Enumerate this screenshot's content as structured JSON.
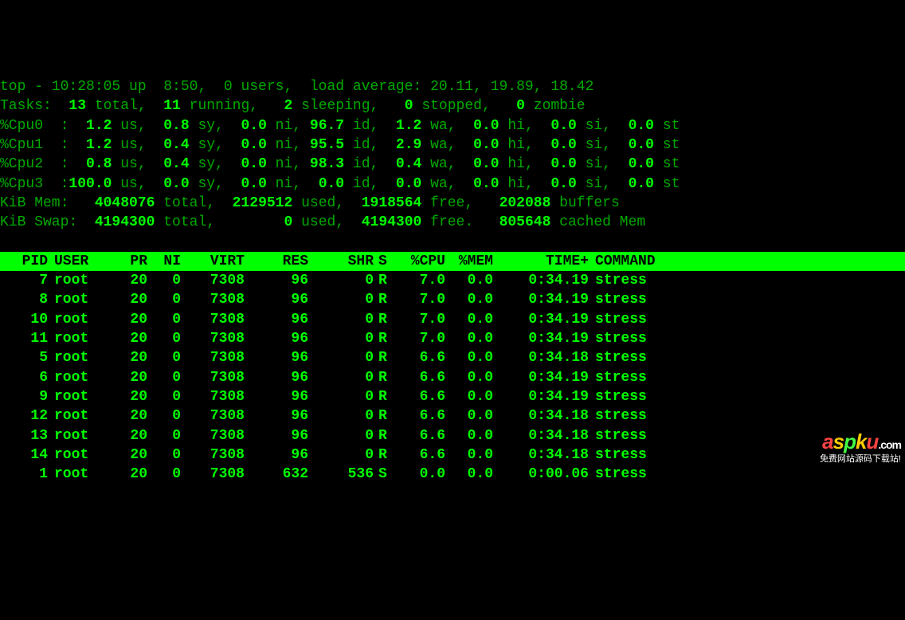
{
  "summary": {
    "top_line_prefix": "top - ",
    "time": "10:28:05",
    "up_label": " up  ",
    "uptime": "8:50",
    "users_sep": ",  ",
    "users_count": "0",
    "users_label": " users,  load average: ",
    "load_avg": "20.11, 19.89, 18.42",
    "tasks_label": "Tasks:  ",
    "tasks_total": "13",
    "tasks_total_lbl": " total,  ",
    "tasks_running": "11",
    "tasks_running_lbl": " running,  ",
    "tasks_sleeping": " 2",
    "tasks_sleeping_lbl": " sleeping,  ",
    "tasks_stopped": " 0",
    "tasks_stopped_lbl": " stopped,  ",
    "tasks_zombie": " 0",
    "tasks_zombie_lbl": " zombie",
    "cpus": [
      {
        "label": "%Cpu0  :  ",
        "us": "1.2",
        "sy": "0.8",
        "ni": "0.0",
        "id": "96.7",
        "wa": "1.2",
        "hi": "0.0",
        "si": "0.0",
        "st": "0.0"
      },
      {
        "label": "%Cpu1  :  ",
        "us": "1.2",
        "sy": "0.4",
        "ni": "0.0",
        "id": "95.5",
        "wa": "2.9",
        "hi": "0.0",
        "si": "0.0",
        "st": "0.0"
      },
      {
        "label": "%Cpu2  :  ",
        "us": "0.8",
        "sy": "0.4",
        "ni": "0.0",
        "id": "98.3",
        "wa": "0.4",
        "hi": "0.0",
        "si": "0.0",
        "st": "0.0"
      },
      {
        "label": "%Cpu3  :",
        "us": "100.0",
        "sy": "0.0",
        "ni": "0.0",
        "id": " 0.0",
        "wa": "0.0",
        "hi": "0.0",
        "si": "0.0",
        "st": "0.0"
      }
    ],
    "mem_label": "KiB Mem:   ",
    "mem_total": "4048076",
    "mem_total_lbl": " total,  ",
    "mem_used": "2129512",
    "mem_used_lbl": " used,  ",
    "mem_free": "1918564",
    "mem_free_lbl": " free,   ",
    "mem_buffers": "202088",
    "mem_buffers_lbl": " buffers",
    "swap_label": "KiB Swap:  ",
    "swap_total": "4194300",
    "swap_total_lbl": " total,        ",
    "swap_used": "0",
    "swap_used_lbl": " used,  ",
    "swap_free": "4194300",
    "swap_free_lbl": " free.   ",
    "swap_cached": "805648",
    "swap_cached_lbl": " cached Mem"
  },
  "columns": {
    "pid": "PID",
    "user": "USER",
    "pr": "PR",
    "ni": "NI",
    "virt": "VIRT",
    "res": "RES",
    "shr": "SHR",
    "s": "S",
    "cpu": "%CPU",
    "mem": "%MEM",
    "time": "TIME+",
    "cmd": "COMMAND"
  },
  "processes": [
    {
      "pid": "7",
      "user": "root",
      "pr": "20",
      "ni": "0",
      "virt": "7308",
      "res": "96",
      "shr": "0",
      "s": "R",
      "cpu": "7.0",
      "mem": "0.0",
      "time": "0:34.19",
      "cmd": "stress"
    },
    {
      "pid": "8",
      "user": "root",
      "pr": "20",
      "ni": "0",
      "virt": "7308",
      "res": "96",
      "shr": "0",
      "s": "R",
      "cpu": "7.0",
      "mem": "0.0",
      "time": "0:34.19",
      "cmd": "stress"
    },
    {
      "pid": "10",
      "user": "root",
      "pr": "20",
      "ni": "0",
      "virt": "7308",
      "res": "96",
      "shr": "0",
      "s": "R",
      "cpu": "7.0",
      "mem": "0.0",
      "time": "0:34.19",
      "cmd": "stress"
    },
    {
      "pid": "11",
      "user": "root",
      "pr": "20",
      "ni": "0",
      "virt": "7308",
      "res": "96",
      "shr": "0",
      "s": "R",
      "cpu": "7.0",
      "mem": "0.0",
      "time": "0:34.19",
      "cmd": "stress"
    },
    {
      "pid": "5",
      "user": "root",
      "pr": "20",
      "ni": "0",
      "virt": "7308",
      "res": "96",
      "shr": "0",
      "s": "R",
      "cpu": "6.6",
      "mem": "0.0",
      "time": "0:34.18",
      "cmd": "stress"
    },
    {
      "pid": "6",
      "user": "root",
      "pr": "20",
      "ni": "0",
      "virt": "7308",
      "res": "96",
      "shr": "0",
      "s": "R",
      "cpu": "6.6",
      "mem": "0.0",
      "time": "0:34.19",
      "cmd": "stress"
    },
    {
      "pid": "9",
      "user": "root",
      "pr": "20",
      "ni": "0",
      "virt": "7308",
      "res": "96",
      "shr": "0",
      "s": "R",
      "cpu": "6.6",
      "mem": "0.0",
      "time": "0:34.19",
      "cmd": "stress"
    },
    {
      "pid": "12",
      "user": "root",
      "pr": "20",
      "ni": "0",
      "virt": "7308",
      "res": "96",
      "shr": "0",
      "s": "R",
      "cpu": "6.6",
      "mem": "0.0",
      "time": "0:34.18",
      "cmd": "stress"
    },
    {
      "pid": "13",
      "user": "root",
      "pr": "20",
      "ni": "0",
      "virt": "7308",
      "res": "96",
      "shr": "0",
      "s": "R",
      "cpu": "6.6",
      "mem": "0.0",
      "time": "0:34.18",
      "cmd": "stress"
    },
    {
      "pid": "14",
      "user": "root",
      "pr": "20",
      "ni": "0",
      "virt": "7308",
      "res": "96",
      "shr": "0",
      "s": "R",
      "cpu": "6.6",
      "mem": "0.0",
      "time": "0:34.18",
      "cmd": "stress"
    },
    {
      "pid": "1",
      "user": "root",
      "pr": "20",
      "ni": "0",
      "virt": "7308",
      "res": "632",
      "shr": "536",
      "s": "S",
      "cpu": "0.0",
      "mem": "0.0",
      "time": "0:00.06",
      "cmd": "stress"
    }
  ],
  "watermark": {
    "tagline": "免费网站源码下载站!"
  }
}
